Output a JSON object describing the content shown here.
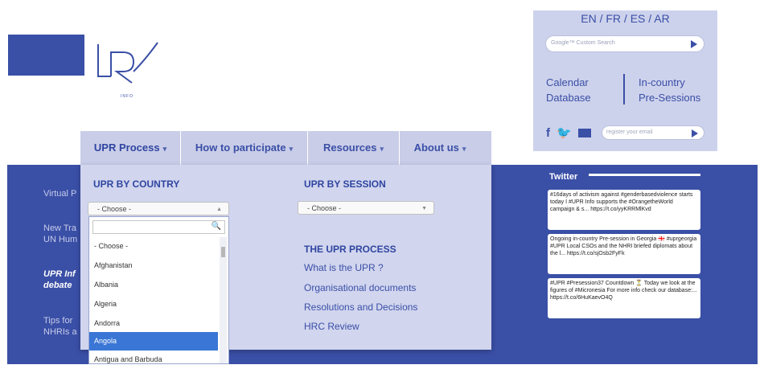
{
  "brand": {
    "logo_text": "UPR",
    "logo_sub": "INFO"
  },
  "header": {
    "languages": [
      "EN",
      "FR",
      "ES",
      "AR"
    ],
    "search_label": "Google™ Custom Search",
    "links": {
      "calendar": "Calendar",
      "database": "Database",
      "incountry": "In-country",
      "presessions": "Pre-Sessions"
    },
    "social": {
      "facebook": "f",
      "twitter": "🐦"
    },
    "register_placeholder": "register your email"
  },
  "nav": {
    "items": [
      {
        "label": "UPR Process",
        "caret": "▾"
      },
      {
        "label": "How to participate",
        "caret": "▾"
      },
      {
        "label": "Resources",
        "caret": "▾"
      },
      {
        "label": "About us",
        "caret": "▾"
      }
    ]
  },
  "dropdown": {
    "by_country": "UPR BY COUNTRY",
    "by_session": "UPR BY SESSION",
    "country_select": "- Choose -",
    "session_select": "- Choose -",
    "process_title": "THE UPR PROCESS",
    "process_links": [
      "What is the UPR ?",
      "Organisational documents",
      "Resolutions and Decisions",
      "HRC Review"
    ],
    "options": [
      "- Choose -",
      "Afghanistan",
      "Albania",
      "Algeria",
      "Andorra",
      "Angola",
      "Antigua and Barbuda"
    ],
    "selected_option": "Angola"
  },
  "background_snippets": [
    "Virtual P",
    "New Tra",
    "UN Hum",
    "UPR Inf",
    "debate",
    "Tips for",
    "NHRIs a"
  ],
  "twitter": {
    "heading": "Twitter",
    "tweets": [
      {
        "text": "#16days of activism against #genderbasedviolence starts today I #UPR Info supports the #OrangetheWorld campaign & s... https://t.co/yyKRRMlKvd"
      },
      {
        "text": "Ongoing in-country Pre-session in Georgia 🇬🇪 #uprgeorgia #UPR Local CSOs and the NHRI briefed diplomats about the l... https://t.co/sjOsb2FyFk"
      },
      {
        "text": "#UPR #Presession37 Countdown ⏳ Today we look at the figures of #Micronesia For more info check our database:... https://t.co/6HuKaevO4Q"
      }
    ]
  }
}
